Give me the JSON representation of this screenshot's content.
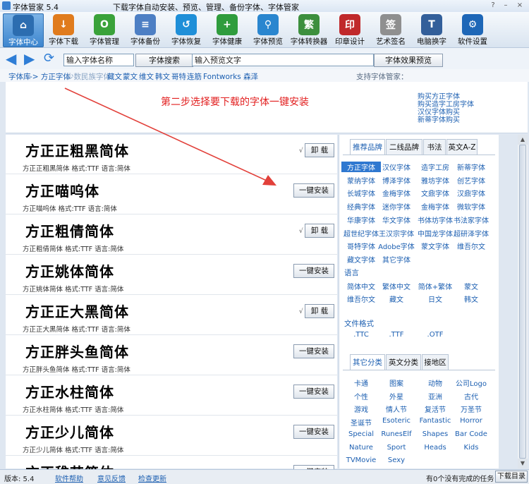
{
  "window": {
    "title": "字体管家 5.4",
    "subtitle": "下载字体自动安装、预览、管理、备份字体、字体管家",
    "controls": [
      "?",
      "–",
      "×"
    ]
  },
  "toolbar": [
    {
      "label": "字体中心",
      "icon": "home-icon",
      "color": "#2c6db0",
      "glyph": "⌂",
      "active": true
    },
    {
      "label": "字体下载",
      "icon": "download-icon",
      "color": "#e07b1d",
      "glyph": "↓"
    },
    {
      "label": "字体管理",
      "icon": "font-manage-icon",
      "color": "#3aa23a",
      "glyph": "O"
    },
    {
      "label": "字体备份",
      "icon": "document-icon",
      "color": "#4d7fc4",
      "glyph": "≡"
    },
    {
      "label": "字体恢复",
      "icon": "restore-icon",
      "color": "#1f8fd8",
      "glyph": "↺"
    },
    {
      "label": "字体健康",
      "icon": "health-kit-icon",
      "color": "#2f9c3d",
      "glyph": "+"
    },
    {
      "label": "字体预览",
      "icon": "magnifier-icon",
      "color": "#2a86cf",
      "glyph": "⚲"
    },
    {
      "label": "字体转换器",
      "icon": "converter-icon",
      "color": "#3d8f3d",
      "glyph": "繁"
    },
    {
      "label": "印章设计",
      "icon": "seal-icon",
      "color": "#c0292b",
      "glyph": "印"
    },
    {
      "label": "艺术签名",
      "icon": "signature-icon",
      "color": "#8f8f8f",
      "glyph": "签"
    },
    {
      "label": "电脑换字",
      "icon": "monitor-icon",
      "color": "#335f9a",
      "glyph": "T"
    },
    {
      "label": "软件设置",
      "icon": "gear-icon",
      "color": "#1e67b7",
      "glyph": "⚙"
    }
  ],
  "search": {
    "name_placeholder": "输入字体名称",
    "search_button": "字体搜索",
    "preview_placeholder": "输入预览文字",
    "preview_button": "字体效果预览"
  },
  "categories": [
    "字体库",
    "-> 方正字体",
    "少数民族字体",
    "藏文",
    "蒙文",
    "维文",
    "韩文",
    "哥特",
    "连筋",
    "Fontworks 森泽"
  ],
  "support_label": "支持字体管家：",
  "banner": {
    "message": "第二步选择要下载的字体一键安装",
    "buy_links": [
      "购买方正字体",
      "购买造字工房字体",
      "汉仪字体购买",
      "新蒂字体购买"
    ]
  },
  "fonts": [
    {
      "sample": "方正正粗黑简体",
      "meta": "方正正粗黑简体  格式:TTF 语言:简体",
      "installed": true,
      "button": "卸 载"
    },
    {
      "sample": "方正喵呜体",
      "meta": "方正喵呜体  格式:TTF 语言:简体",
      "installed": false,
      "button": "一键安装"
    },
    {
      "sample": "方正粗倩简体",
      "meta": "方正粗倩简体  格式:TTF 语言:简体",
      "installed": true,
      "button": "卸 载"
    },
    {
      "sample": "方正姚体简体",
      "meta": "方正姚体简体  格式:TTF 语言:简体",
      "installed": false,
      "button": "一键安装"
    },
    {
      "sample": "方正正大黑简体",
      "meta": "方正正大黑简体  格式:TTF 语言:简体",
      "installed": true,
      "button": "卸 载"
    },
    {
      "sample": "方正胖头鱼简体",
      "meta": "方正胖头鱼简体  格式:TTF 语言:简体",
      "installed": false,
      "button": "一键安装"
    },
    {
      "sample": "方正水柱简体",
      "meta": "方正水柱简体  格式:TTF 语言:简体",
      "installed": false,
      "button": "一键安装"
    },
    {
      "sample": "方正少儿简体",
      "meta": "方正少儿简体  格式:TTF 语言:简体",
      "installed": false,
      "button": "一键安装"
    },
    {
      "sample": "方正稚艺简体",
      "meta": "",
      "installed": false,
      "button": "一键安装"
    }
  ],
  "right_panel": {
    "brand_tabs": [
      "推荐品牌",
      "二线品牌",
      "书法",
      "英文A-Z"
    ],
    "brands": [
      "方正字体",
      "汉仪字体",
      "造字工房",
      "新蒂字体",
      "蒙纳字体",
      "博泽字体",
      "雅坊字体",
      "创艺字体",
      "长城字体",
      "金梅字体",
      "文鼎字体",
      "汉鼎字体",
      "经典字体",
      "迷你字体",
      "金梅字体",
      "微软字体",
      "华康字体",
      "华文字体",
      "书体坊字体",
      "书法家字体",
      "超世纪字体",
      "王汉宗字体",
      "中国龙字体",
      "超研泽字体",
      "哥特字体",
      "Adobe字体",
      "蒙文字体",
      "维吾尔文",
      "藏文字体",
      "其它字体"
    ],
    "language_title": "语言",
    "languages": [
      "简体中文",
      "繁体中文",
      "简体+繁体",
      "蒙文",
      "维吾尔文",
      "藏文",
      "日文",
      "韩文"
    ],
    "format_title": "文件格式",
    "formats": [
      ".TTC",
      ".TTF",
      ".OTF"
    ],
    "category_tabs": [
      "其它分类",
      "英文分类",
      "接地区"
    ],
    "misc": [
      "卡通",
      "图案",
      "动物",
      "公司Logo",
      "个性",
      "外星",
      "亚洲",
      "古代",
      "游戏",
      "情人节",
      "复活节",
      "万圣节",
      "圣诞节",
      "Esoteric",
      "Fantastic",
      "Horror",
      "Special",
      "RunesElf",
      "Shapes",
      "Bar Code",
      "Nature",
      "Sport",
      "Heads",
      "Kids",
      "TVMovie",
      "Sexy"
    ]
  },
  "status": {
    "version": "版本: 5.4",
    "help": "软件帮助",
    "feedback": "意见反馈",
    "update": "检查更新",
    "tasks": "有0个没有完成的任务",
    "download_dir": "下载目录"
  },
  "colors": {
    "accent": "#2f78d0",
    "banner_text": "#e21f1f",
    "arrow": "#e2403a",
    "link": "#1c5fb1"
  }
}
